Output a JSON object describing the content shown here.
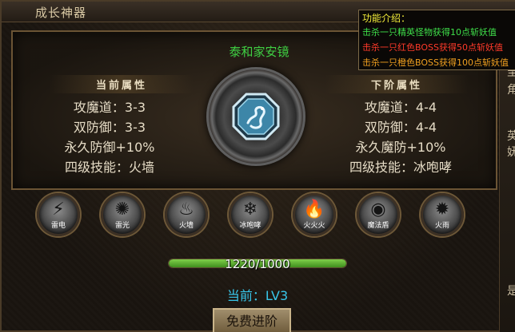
{
  "window": {
    "title": "成长神器"
  },
  "artifact": {
    "name": "泰和家安镜",
    "emblem_icon": "dragon-emblem-icon"
  },
  "current_attrs": {
    "header": "当前属性",
    "lines": [
      "攻魔道：3-3",
      "双防御：3-3",
      "永久防御+10%",
      "四级技能：火墙"
    ]
  },
  "next_attrs": {
    "header": "下阶属性",
    "lines": [
      "攻魔道：4-4",
      "双防御：4-4",
      "永久魔防+10%",
      "四级技能：冰咆哮"
    ]
  },
  "skills": [
    {
      "label": "雷电",
      "icon": "lightning-icon"
    },
    {
      "label": "雷光",
      "icon": "thunder-burst-icon"
    },
    {
      "label": "火墙",
      "icon": "fire-wall-icon"
    },
    {
      "label": "冰咆哮",
      "icon": "snowflake-icon"
    },
    {
      "label": "火火火",
      "icon": "flame-icon"
    },
    {
      "label": "魔法盾",
      "icon": "shield-ring-icon"
    },
    {
      "label": "火雨",
      "icon": "fire-rain-icon"
    }
  ],
  "progress": {
    "text": "1220/1000",
    "fraction": 1.0
  },
  "level": {
    "text": "当前：LV3"
  },
  "advance_button": {
    "label": "免费进阶"
  },
  "tooltip": {
    "title": "功能介绍：",
    "lines": [
      {
        "text": "击杀一只精英怪物获得10点斩妖值",
        "color": "#3fe04a"
      },
      {
        "text": "击杀一只红色BOSS获得50点斩妖值",
        "color": "#ff3a2a"
      },
      {
        "text": "击杀一只橙色BOSS获得100点斩妖值",
        "color": "#f0a020"
      }
    ]
  },
  "side_panel": {
    "chars": [
      "圭",
      "角",
      "英",
      "妩",
      "是"
    ]
  },
  "colors": {
    "accent_green": "#3fd043",
    "level_cyan": "#38c6e9",
    "frame_brown": "#6b5434"
  }
}
